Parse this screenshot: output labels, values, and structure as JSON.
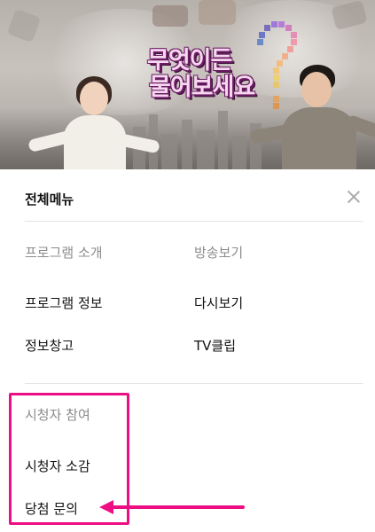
{
  "hero": {
    "logo_line1": "무엇이든",
    "logo_line2": "물어보세요"
  },
  "menu": {
    "title": "전체메뉴",
    "close_icon": "close-icon",
    "sections": [
      {
        "heading": "프로그램 소개",
        "items": [
          "프로그램 정보",
          "정보창고"
        ]
      },
      {
        "heading": "방송보기",
        "items": [
          "다시보기",
          "TV클립"
        ]
      },
      {
        "heading": "시청자 참여",
        "items": [
          "시청자 소감",
          "당첨 문의"
        ]
      }
    ]
  },
  "annotation": {
    "highlight_color": "#ee0e84",
    "arrow_target": "당첨 문의"
  }
}
